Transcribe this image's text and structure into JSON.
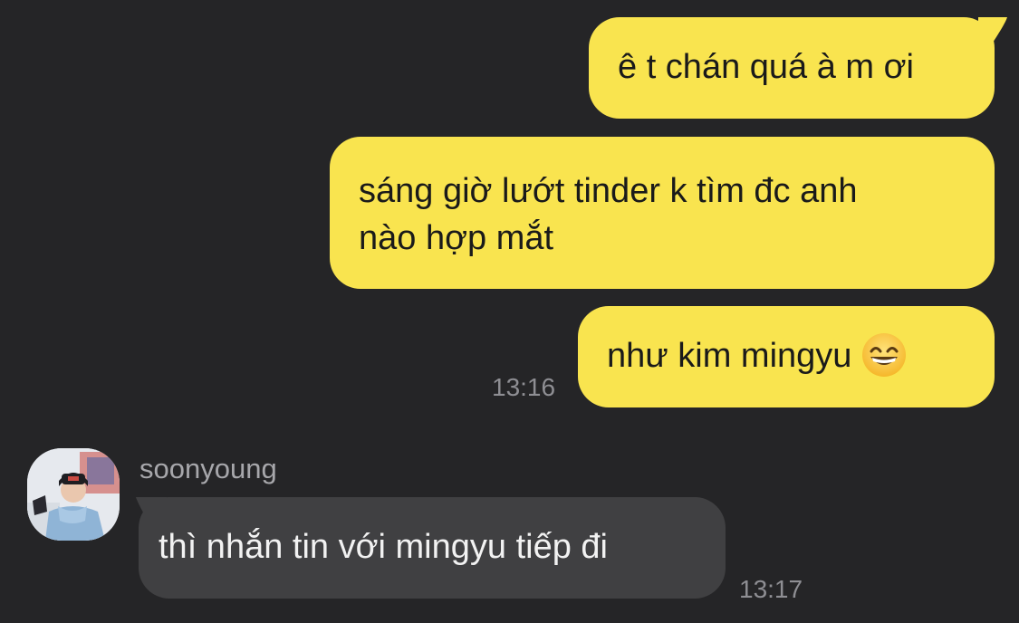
{
  "conversation": {
    "outgoing": [
      {
        "text": "ê t chán quá à m ơi"
      },
      {
        "line1": "sáng giờ lướt tinder k tìm đc anh",
        "line2": "nào hợp mắt"
      },
      {
        "text": "như kim mingyu",
        "emoji": "grinning-face-with-smiling-eyes-icon"
      }
    ],
    "outgoing_time": "13:16",
    "incoming": {
      "sender": "soonyoung",
      "text": "thì nhắn tin với mingyu tiếp đi",
      "time": "13:17"
    }
  },
  "colors": {
    "background": "#252527",
    "outgoing_bubble": "#F9E44F",
    "incoming_bubble": "#404042",
    "timestamp": "#8E8E93"
  }
}
